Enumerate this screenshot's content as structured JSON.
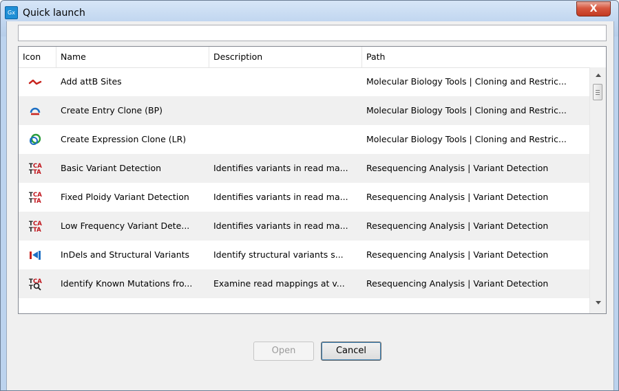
{
  "window": {
    "title": "Quick launch",
    "app_icon_text": "Gx",
    "close_symbol": "X"
  },
  "search": {
    "value": ""
  },
  "table": {
    "columns": [
      "Icon",
      "Name",
      "Description",
      "Path"
    ],
    "rows": [
      {
        "icon": "attb-sites-icon",
        "name": "Add attB Sites",
        "description": "",
        "path": "Molecular Biology Tools | Cloning and Restric..."
      },
      {
        "icon": "entry-clone-icon",
        "name": "Create Entry Clone (BP)",
        "description": "",
        "path": "Molecular Biology Tools | Cloning and Restric..."
      },
      {
        "icon": "expression-clone-icon",
        "name": "Create Expression Clone (LR)",
        "description": "",
        "path": "Molecular Biology Tools | Cloning and Restric..."
      },
      {
        "icon": "variant-detection-icon",
        "name": "Basic Variant Detection",
        "description": "Identifies variants in read ma...",
        "path": "Resequencing Analysis | Variant Detection"
      },
      {
        "icon": "variant-detection-icon",
        "name": "Fixed Ploidy Variant Detection",
        "description": "Identifies variants in read ma...",
        "path": "Resequencing Analysis | Variant Detection"
      },
      {
        "icon": "variant-detection-icon",
        "name": "Low Frequency Variant Dete...",
        "description": "Identifies variants in read ma...",
        "path": "Resequencing Analysis | Variant Detection"
      },
      {
        "icon": "structural-variants-icon",
        "name": "InDels and Structural Variants",
        "description": "Identify structural variants s...",
        "path": "Resequencing Analysis | Variant Detection"
      },
      {
        "icon": "known-mutations-icon",
        "name": "Identify Known Mutations fro...",
        "description": "Examine read mappings at v...",
        "path": "Resequencing Analysis | Variant Detection"
      }
    ]
  },
  "buttons": {
    "open": "Open",
    "cancel": "Cancel"
  },
  "colors": {
    "titlebar": "#c2d7f0",
    "close_button": "#c23a21",
    "row_alt": "#f0f0f0",
    "variant_icon_red": "#c0141b"
  }
}
